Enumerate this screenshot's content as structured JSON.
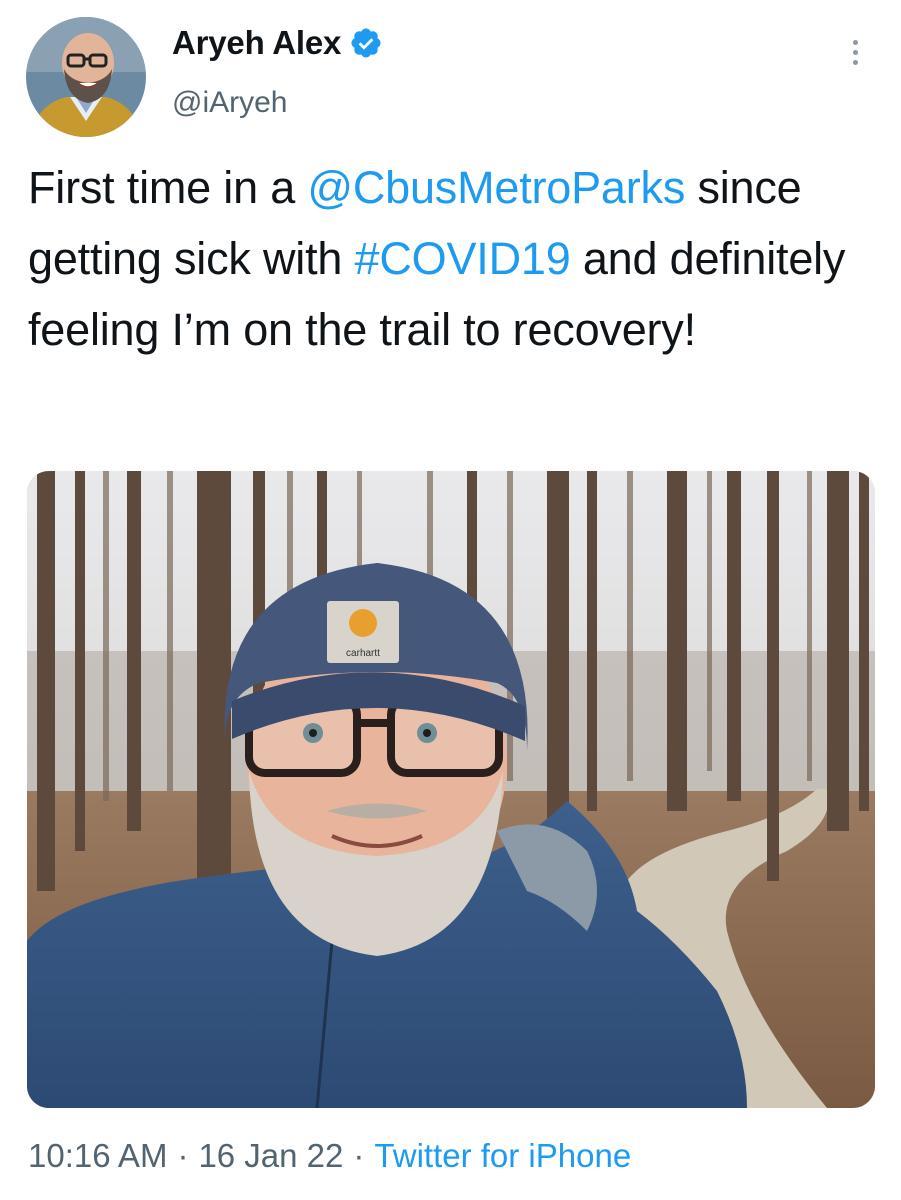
{
  "author": {
    "display_name": "Aryeh Alex",
    "handle": "@iAryeh",
    "verified": true
  },
  "tweet": {
    "text_parts": [
      "First time in a ",
      "@CbusMetroParks",
      " since getting sick with ",
      "#COVID19",
      " and definitely feeling I’m on the trail to recovery!"
    ],
    "mention": "@CbusMetroParks",
    "hashtag": "#COVID19"
  },
  "media": {
    "alt": "",
    "hat_label": "carhartt"
  },
  "footer": {
    "time": "10:16 AM",
    "separator": "·",
    "date": "16 Jan 22",
    "source": "Twitter for iPhone"
  },
  "icons": {
    "verified": "verified-badge-icon",
    "more": "more-options-icon"
  },
  "colors": {
    "accent": "#1d9bf0",
    "text": "#0f1419",
    "secondary": "#536471"
  }
}
